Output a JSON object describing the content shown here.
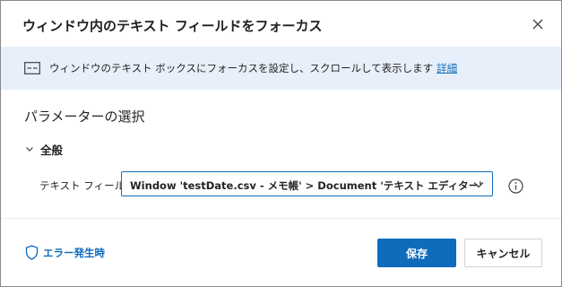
{
  "dialog": {
    "title": "ウィンドウ内のテキスト フィールドをフォーカス"
  },
  "info_bar": {
    "icon": "textbox-icon",
    "text": "ウィンドウのテキスト ボックスにフォーカスを設定し、スクロールして表示します",
    "link_label": "詳細"
  },
  "parameters": {
    "section_title": "パラメーターの選択",
    "group_label": "全般",
    "field_label": "テキスト フィールド:",
    "field_value": "Window 'testDate.csv - メモ帳' > Document 'テキスト エディター'"
  },
  "footer": {
    "error_label": "エラー発生時",
    "save_label": "保存",
    "cancel_label": "キャンセル"
  },
  "colors": {
    "accent": "#0f6cbd",
    "info_background": "#e7f0fa"
  }
}
